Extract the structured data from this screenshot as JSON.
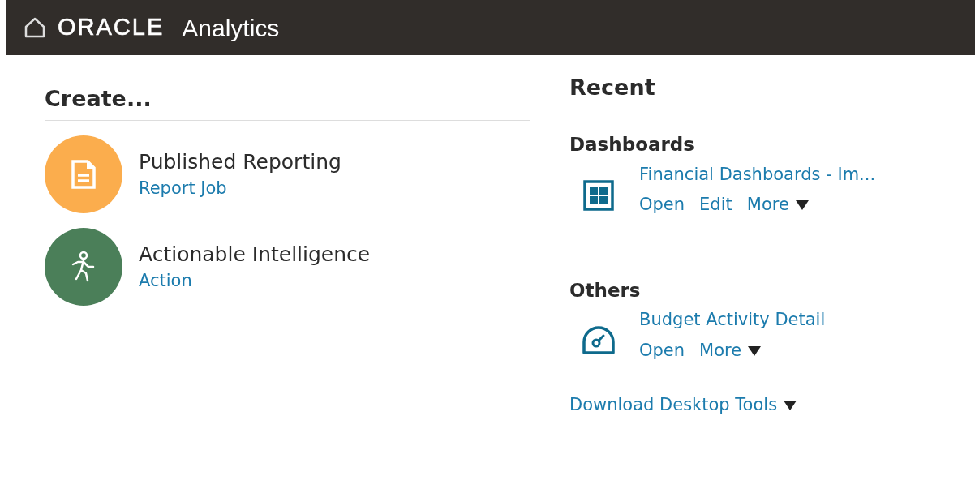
{
  "header": {
    "brand": "ORACLE",
    "product": "Analytics"
  },
  "create": {
    "title": "Create...",
    "items": [
      {
        "kind": "report",
        "color": "#fbad4d",
        "title": "Published Reporting",
        "link": "Report Job"
      },
      {
        "kind": "action",
        "color": "#4b7f59",
        "title": "Actionable Intelligence",
        "link": "Action"
      }
    ]
  },
  "recent": {
    "title": "Recent",
    "sections": [
      {
        "title": "Dashboards",
        "items": [
          {
            "kind": "dashboard",
            "name": "Financial Dashboards - Im...",
            "actions": [
              {
                "label": "Open",
                "menu": false
              },
              {
                "label": "Edit",
                "menu": false
              },
              {
                "label": "More",
                "menu": true
              }
            ]
          }
        ]
      },
      {
        "title": "Others",
        "items": [
          {
            "kind": "gauge",
            "name": "Budget Activity Detail",
            "actions": [
              {
                "label": "Open",
                "menu": false
              },
              {
                "label": "More",
                "menu": true
              }
            ]
          }
        ]
      }
    ],
    "download": "Download Desktop Tools"
  }
}
